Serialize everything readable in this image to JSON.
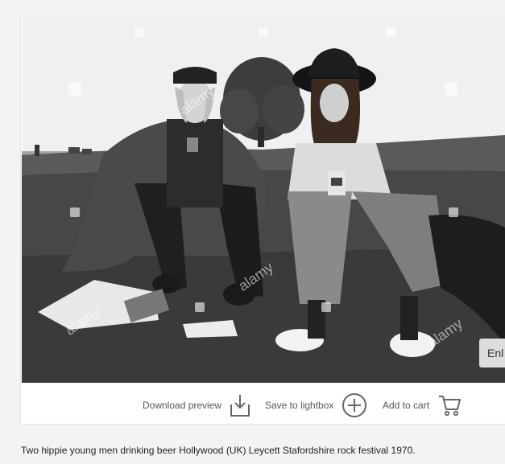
{
  "image": {
    "alt": "Two hippie young men drinking beer Hollywood (UK) Leycett Stafordshire rock festival 1970.",
    "watermark": "alamy",
    "watermark_small": "a",
    "enlarge_label": "Enl"
  },
  "actions": {
    "download_label": "Download preview",
    "lightbox_label": "Save to lightbox",
    "cart_label": "Add to cart",
    "icons": [
      "download-icon",
      "plus-circle-icon",
      "cart-icon"
    ]
  },
  "caption": "Two hippie young men drinking beer Hollywood (UK) Leycett Stafordshire rock festival 1970.",
  "colors": {
    "background": "#f3f3f3",
    "card": "#ffffff",
    "action_text": "#555555",
    "icon": "#666666"
  }
}
